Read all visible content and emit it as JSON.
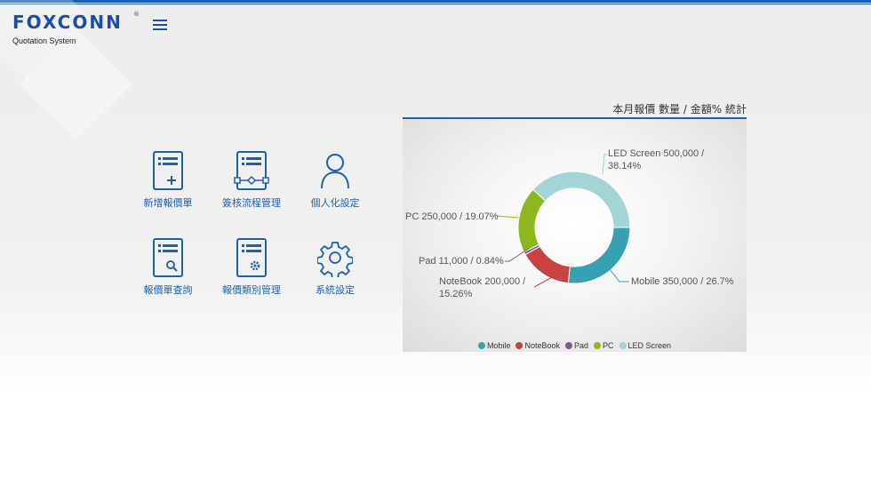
{
  "brand": {
    "logo_text": "FOXCONN",
    "registered": "®",
    "subtitle": "Quotation System"
  },
  "menu": {
    "icon": "hamburger-icon"
  },
  "tiles": [
    {
      "label": "新增報價單",
      "icon": "new-quote-icon"
    },
    {
      "label": "簽核流程管理",
      "icon": "workflow-icon"
    },
    {
      "label": "個人化設定",
      "icon": "user-icon"
    },
    {
      "label": "報價單查詢",
      "icon": "quote-search-icon"
    },
    {
      "label": "報價類別管理",
      "icon": "category-settings-icon"
    },
    {
      "label": "系統設定",
      "icon": "gear-icon"
    }
  ],
  "chart": {
    "title": "本月報價 數量 / 金額% 統計",
    "colors": {
      "accent": "#1f5fb0"
    }
  },
  "chart_data": {
    "type": "pie",
    "title": "本月報價 數量 / 金額% 統計",
    "donut": true,
    "legend_position": "bottom",
    "slices": [
      {
        "name": "Mobile",
        "value": 350000,
        "percent": 26.7,
        "color": "#36a1b0",
        "label_text": "Mobile 350,000 / 26.7%"
      },
      {
        "name": "NoteBook",
        "value": 200000,
        "percent": 15.26,
        "color": "#c8423f",
        "label_text": "NoteBook 200,000 / 15.26%"
      },
      {
        "name": "Pad",
        "value": 11000,
        "percent": 0.84,
        "color": "#7e5b8d",
        "label_text": "Pad 11,000 / 0.84%"
      },
      {
        "name": "PC",
        "value": 250000,
        "percent": 19.07,
        "color": "#8db81d",
        "label_text": "PC 250,000 / 19.07%"
      },
      {
        "name": "LED Screen",
        "value": 500000,
        "percent": 38.14,
        "color": "#a3d4d6",
        "label_text": "LED Screen 500,000 / 38.14%"
      }
    ]
  }
}
